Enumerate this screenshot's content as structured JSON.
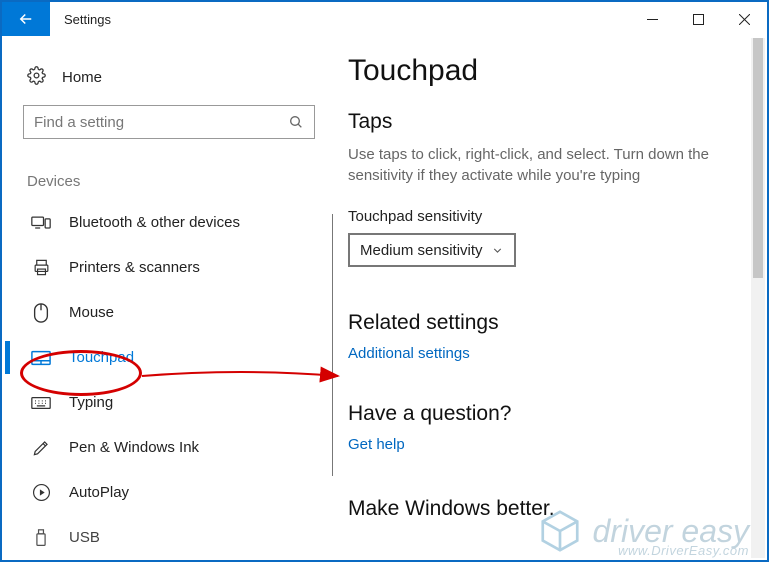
{
  "window": {
    "title": "Settings"
  },
  "sidebar": {
    "home": "Home",
    "search_placeholder": "Find a setting",
    "group": "Devices",
    "items": [
      {
        "label": "Bluetooth & other devices"
      },
      {
        "label": "Printers & scanners"
      },
      {
        "label": "Mouse"
      },
      {
        "label": "Touchpad"
      },
      {
        "label": "Typing"
      },
      {
        "label": "Pen & Windows Ink"
      },
      {
        "label": "AutoPlay"
      },
      {
        "label": "USB"
      }
    ]
  },
  "content": {
    "title": "Touchpad",
    "taps": {
      "heading": "Taps",
      "desc": "Use taps to click, right-click, and select. Turn down the sensitivity if they activate while you're typing",
      "field_label": "Touchpad sensitivity",
      "field_value": "Medium sensitivity"
    },
    "related": {
      "heading": "Related settings",
      "link": "Additional settings"
    },
    "question": {
      "heading": "Have a question?",
      "link": "Get help"
    },
    "better": {
      "heading": "Make Windows better."
    }
  },
  "watermark": {
    "main": "driver easy",
    "sub": "www.DriverEasy.com"
  }
}
